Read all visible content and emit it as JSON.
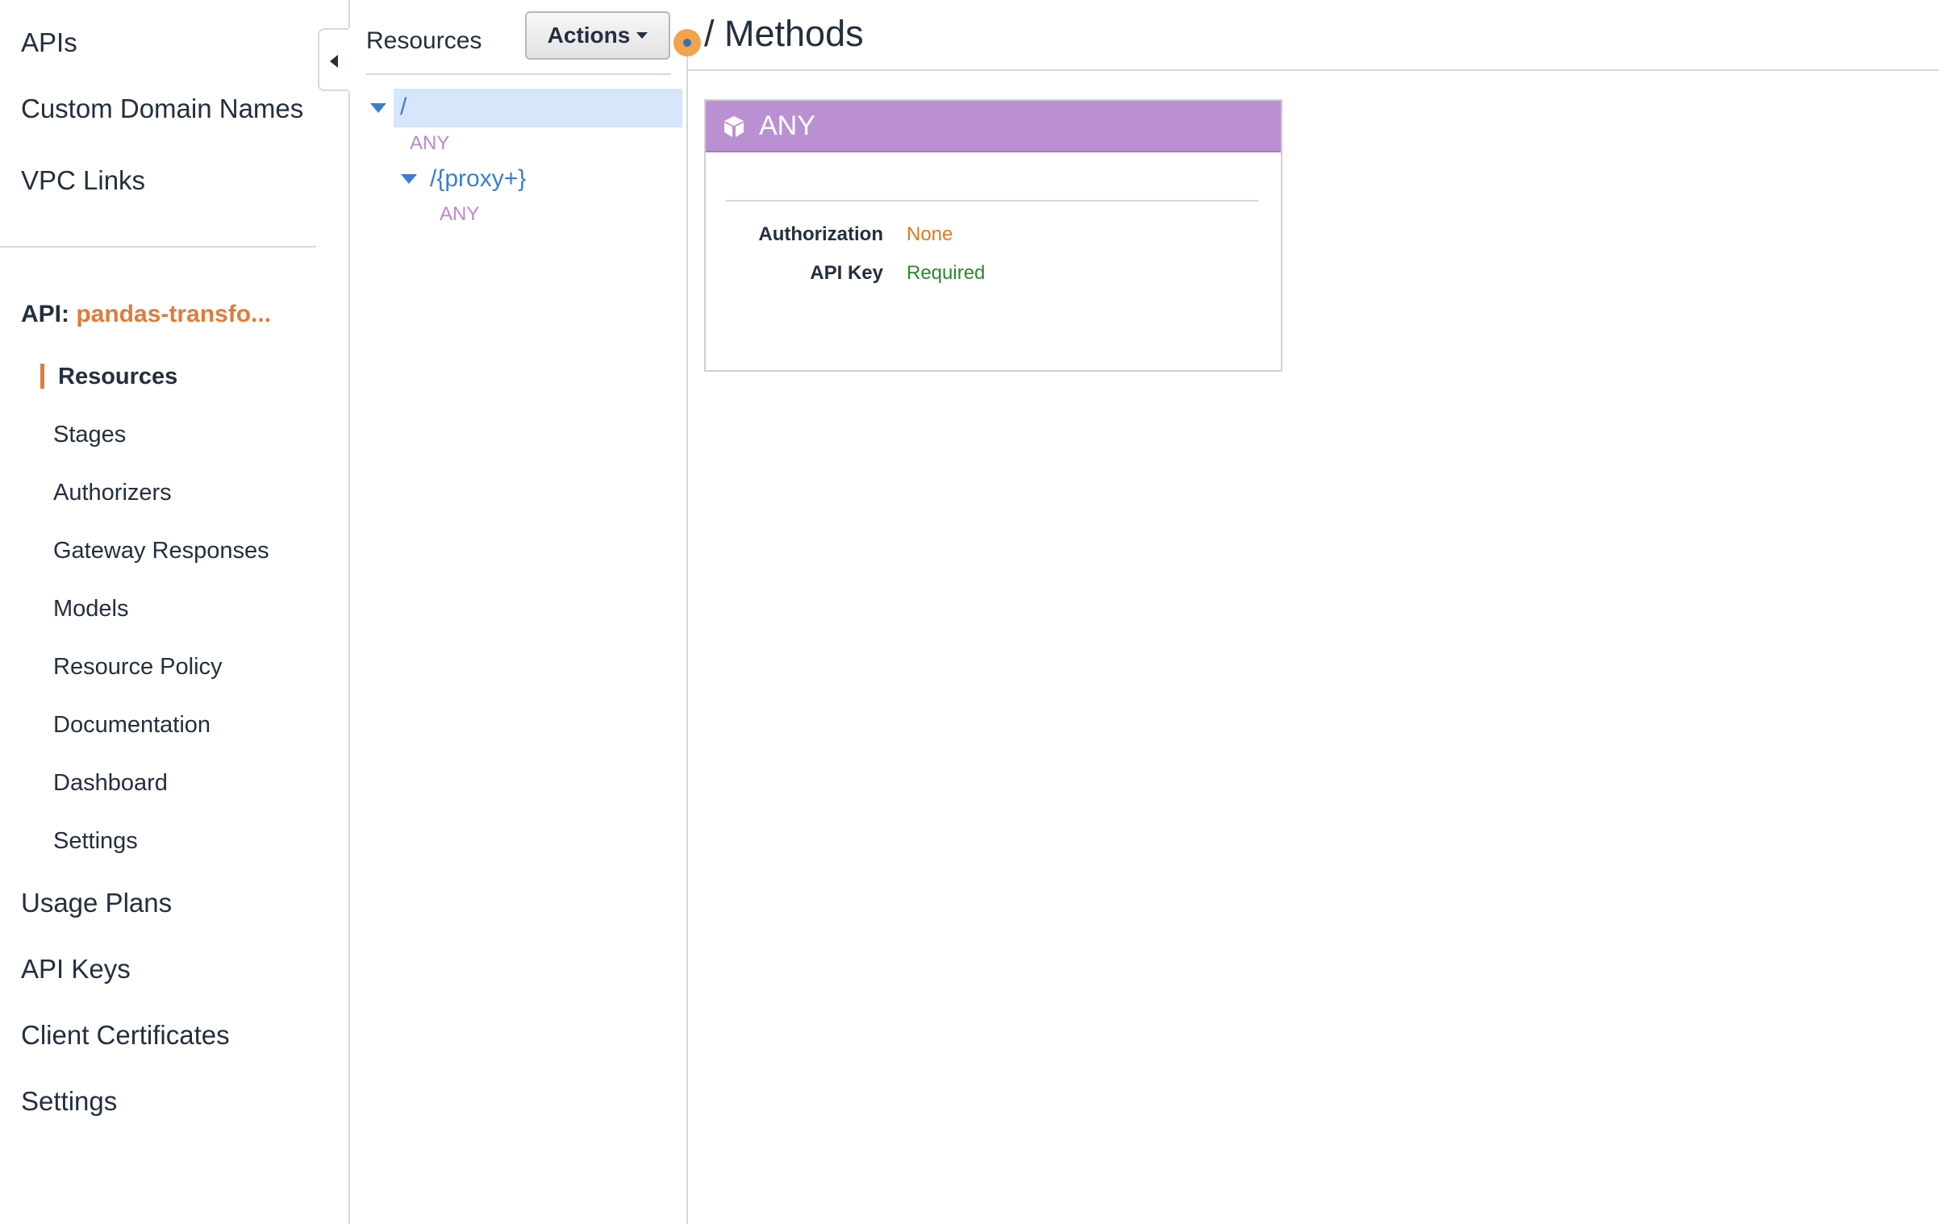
{
  "nav": {
    "top_items": [
      "APIs",
      "Custom Domain Names",
      "VPC Links"
    ],
    "api_prefix": "API:",
    "api_name": "pandas-transfo...",
    "sub_items": [
      "Resources",
      "Stages",
      "Authorizers",
      "Gateway Responses",
      "Models",
      "Resource Policy",
      "Documentation",
      "Dashboard",
      "Settings"
    ],
    "bottom_items": [
      "Usage Plans",
      "API Keys",
      "Client Certificates",
      "Settings"
    ]
  },
  "resources": {
    "title": "Resources",
    "actions_label": "Actions",
    "tree": {
      "root_path": "/",
      "root_method": "ANY",
      "child_path": "/{proxy+}",
      "child_method": "ANY"
    }
  },
  "main": {
    "title": "/ Methods",
    "method": {
      "name": "ANY",
      "header_color": "#bb90d2",
      "authorization_label": "Authorization",
      "authorization_value": "None",
      "api_key_label": "API Key",
      "api_key_value": "Required"
    }
  },
  "colors": {
    "accent": "#e07b39",
    "link": "#3a7ecf",
    "method": "#c283d4",
    "none": "#e07b1f",
    "required": "#2a8a2a",
    "selected": "#d6e6fb"
  }
}
